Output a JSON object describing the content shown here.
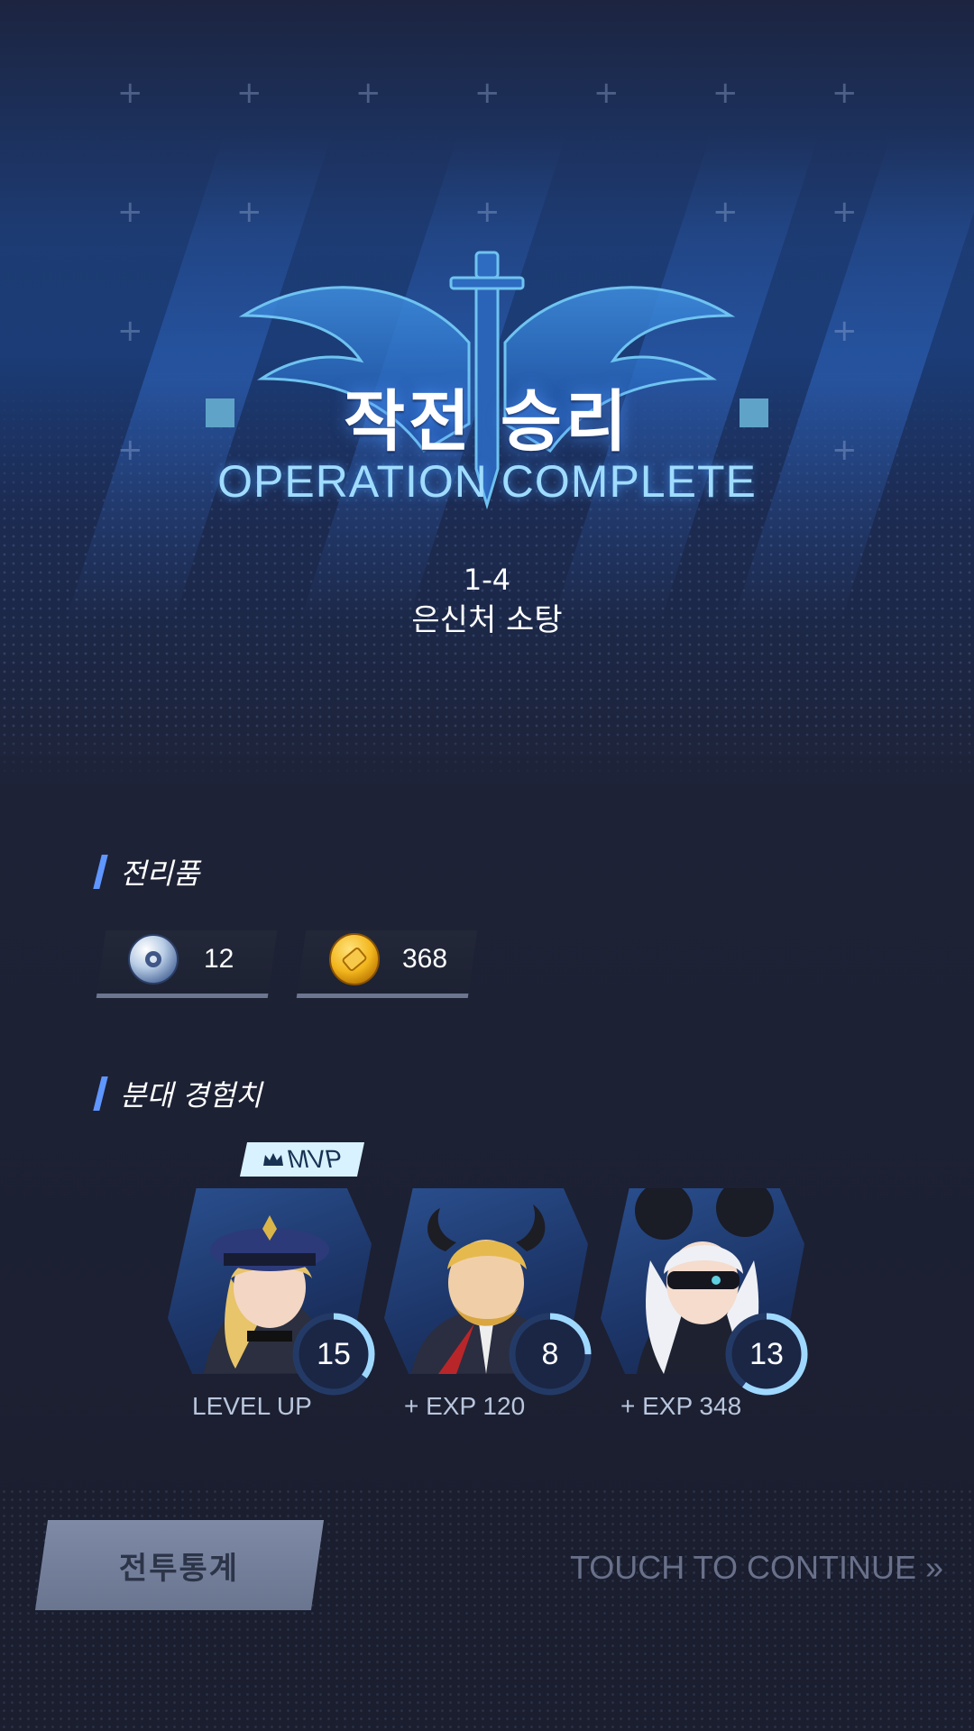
{
  "header": {
    "title_kr": "작전 승리",
    "title_en": "OPERATION COMPLETE"
  },
  "stage": {
    "number": "1-4",
    "name": "은신처 소탕"
  },
  "rewards_section": {
    "title": "전리품",
    "items": [
      {
        "icon": "disc-icon",
        "value": "12"
      },
      {
        "icon": "gold-coin-icon",
        "value": "368"
      }
    ]
  },
  "exp_section": {
    "title": "분대 경험치",
    "mvp_label": "MVP",
    "members": [
      {
        "level": "15",
        "result": "LEVEL UP",
        "exp_progress": 0.35
      },
      {
        "level": "8",
        "result": "+ EXP 120",
        "exp_progress": 0.25
      },
      {
        "level": "13",
        "result": "+ EXP 348",
        "exp_progress": 0.6
      }
    ]
  },
  "footer": {
    "stats_button": "전투통계",
    "continue_label": "TOUCH TO CONTINUE »"
  },
  "colors": {
    "accent_blue": "#5f96ff",
    "title_glow": "#9fdcff",
    "mvp_badge": "#d8f2ff",
    "gold": "#f2b61d"
  }
}
